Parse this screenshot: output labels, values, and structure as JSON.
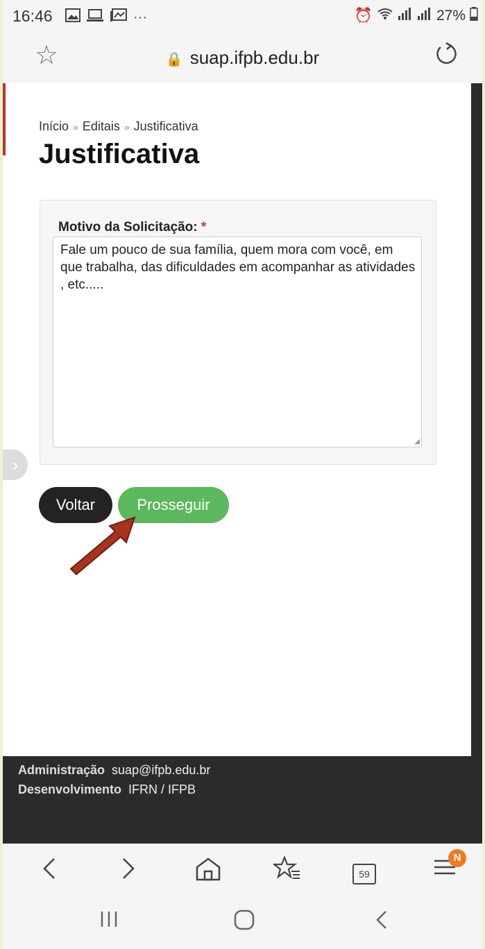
{
  "status": {
    "time": "16:46",
    "battery": "27%"
  },
  "browser": {
    "url": "suap.ifpb.edu.br"
  },
  "page": {
    "breadcrumb": [
      "Início",
      "Editais",
      "Justificativa"
    ],
    "breadcrumb_sep": "»",
    "title": "Justificativa",
    "form": {
      "label": "Motivo da Solicitação:",
      "required_mark": "*",
      "textarea_value": "Fale um pouco de sua família, quem mora com você, em que trabalha, das dificuldades em acompanhar as atividades , etc....."
    },
    "buttons": {
      "back": "Voltar",
      "proceed": "Prosseguir"
    }
  },
  "footer": {
    "admin_label": "Administração",
    "admin_value": "suap@ifpb.edu.br",
    "dev_label": "Desenvolvimento",
    "dev_value": "IFRN / IFPB"
  },
  "toolbar": {
    "tabs_count": "59",
    "menu_badge": "N"
  },
  "colors": {
    "proceed": "#5cb85c",
    "back": "#232323",
    "footer_bg": "#2b2b2b",
    "arrow": "#a8321c",
    "badge": "#f07b1e"
  }
}
